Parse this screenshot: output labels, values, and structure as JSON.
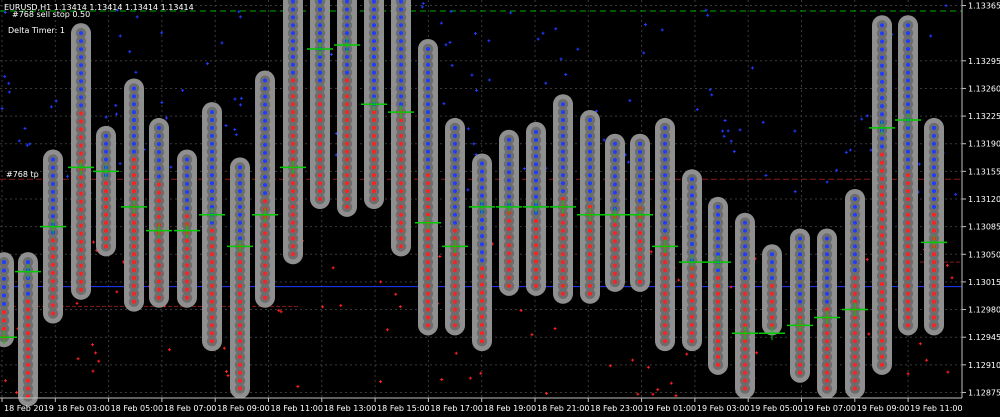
{
  "header": {
    "symbol_line": "EURUSD,H1  1.13414 1.13414 1.13414 1.13414",
    "order_line": "#768 sell stop 0.50",
    "delta_timer": "Delta Timer: 1",
    "tp_label": "#768 tp"
  },
  "colors": {
    "background": "#000000",
    "grid": "#3a3a3a",
    "axis_text": "#ffffff",
    "bubble": "#8f8f8f",
    "ask_dot": "#1e3cff",
    "bid_dot": "#ff2020",
    "level": "#00cc00",
    "tp_line": "#8b1a1a",
    "stop_line": "#00aa00",
    "blue_line": "#1e3cff"
  },
  "chart_data": {
    "type": "scatter",
    "description_free": true,
    "x_ticks": [
      "18 Feb 2019",
      "18 Feb 03:00",
      "18 Feb 05:00",
      "18 Feb 07:00",
      "18 Feb 09:00",
      "18 Feb 11:00",
      "18 Feb 13:00",
      "18 Feb 15:00",
      "18 Feb 17:00",
      "18 Feb 19:00",
      "18 Feb 21:00",
      "18 Feb 23:00",
      "19 Feb 01:00",
      "19 Feb 03:00",
      "19 Feb 05:00",
      "19 Feb 07:00",
      "19 Feb 09:00",
      "19 Feb 11:00"
    ],
    "y_ticks": [
      1.13365,
      1.13295,
      1.1326,
      1.13225,
      1.1319,
      1.13155,
      1.1312,
      1.13085,
      1.1305,
      1.13015,
      1.1298,
      1.12945,
      1.1291,
      1.12875
    ],
    "y_tick_labels": [
      "1.13365",
      "1.13295",
      "1.13260",
      "1.13225",
      "1.13190",
      "1.13155",
      "1.13120",
      "1.13085",
      "1.13050",
      "1.13015",
      "1.12980",
      "1.12945",
      "1.12910",
      "1.12875"
    ],
    "ylim": [
      1.12868,
      1.13372
    ],
    "levels": {
      "sell_stop": 1.13358,
      "take_profit": 1.13145,
      "blue_ref": 1.13009,
      "red_ref": 1.12984
    },
    "bars": [
      {
        "x": 4,
        "high": 1.1304,
        "low": 1.12945,
        "split": 1.1298,
        "level": 1.12945
      },
      {
        "x": 28,
        "high": 1.1304,
        "low": 1.1287,
        "split": 1.13,
        "level": 1.13028
      },
      {
        "x": 53,
        "high": 1.1317,
        "low": 1.12975,
        "split": 1.1307,
        "level": 1.13085
      },
      {
        "x": 81,
        "high": 1.1333,
        "low": 1.13005,
        "split": 1.1323,
        "level": 1.1316
      },
      {
        "x": 106,
        "high": 1.132,
        "low": 1.1306,
        "split": 1.1314,
        "level": 1.13155
      },
      {
        "x": 134,
        "high": 1.1326,
        "low": 1.1299,
        "split": 1.1318,
        "level": 1.1311
      },
      {
        "x": 159,
        "high": 1.1321,
        "low": 1.12995,
        "split": 1.1314,
        "level": 1.1308
      },
      {
        "x": 187,
        "high": 1.1317,
        "low": 1.12995,
        "split": 1.131,
        "level": 1.1308
      },
      {
        "x": 212,
        "high": 1.1323,
        "low": 1.1294,
        "split": 1.1309,
        "level": 1.131
      },
      {
        "x": 240,
        "high": 1.1316,
        "low": 1.1288,
        "split": 1.1306,
        "level": 1.1306
      },
      {
        "x": 265,
        "high": 1.1327,
        "low": 1.12995,
        "split": 1.1312,
        "level": 1.131
      },
      {
        "x": 293,
        "high": 1.1338,
        "low": 1.1305,
        "split": 1.1327,
        "level": 1.1316
      },
      {
        "x": 320,
        "high": 1.1338,
        "low": 1.1312,
        "split": 1.1326,
        "level": 1.1331
      },
      {
        "x": 347,
        "high": 1.1338,
        "low": 1.1311,
        "split": 1.1327,
        "level": 1.13315
      },
      {
        "x": 374,
        "high": 1.1338,
        "low": 1.1312,
        "split": 1.1323,
        "level": 1.1324
      },
      {
        "x": 401,
        "high": 1.1338,
        "low": 1.1306,
        "split": 1.1323,
        "level": 1.1323
      },
      {
        "x": 428,
        "high": 1.1331,
        "low": 1.1296,
        "split": 1.1316,
        "level": 1.1309
      },
      {
        "x": 455,
        "high": 1.1321,
        "low": 1.1296,
        "split": 1.1309,
        "level": 1.1306
      },
      {
        "x": 482,
        "high": 1.13165,
        "low": 1.1294,
        "split": 1.1304,
        "level": 1.1311
      },
      {
        "x": 509,
        "high": 1.13195,
        "low": 1.1301,
        "split": 1.1311,
        "level": 1.1311
      },
      {
        "x": 536,
        "high": 1.13205,
        "low": 1.1301,
        "split": 1.131,
        "level": 1.1311
      },
      {
        "x": 563,
        "high": 1.1324,
        "low": 1.13,
        "split": 1.1312,
        "level": 1.1311
      },
      {
        "x": 590,
        "high": 1.1322,
        "low": 1.13,
        "split": 1.1312,
        "level": 1.131
      },
      {
        "x": 615,
        "high": 1.1319,
        "low": 1.13015,
        "split": 1.131,
        "level": 1.131
      },
      {
        "x": 640,
        "high": 1.1319,
        "low": 1.13015,
        "split": 1.1311,
        "level": 1.131
      },
      {
        "x": 665,
        "high": 1.1321,
        "low": 1.1294,
        "split": 1.1307,
        "level": 1.1306
      },
      {
        "x": 692,
        "high": 1.13145,
        "low": 1.1294,
        "split": 1.1304,
        "level": 1.1304
      },
      {
        "x": 718,
        "high": 1.1311,
        "low": 1.1291,
        "split": 1.1302,
        "level": 1.1304
      },
      {
        "x": 745,
        "high": 1.1309,
        "low": 1.1288,
        "split": 1.1301,
        "level": 1.1295
      },
      {
        "x": 772,
        "high": 1.1305,
        "low": 1.1296,
        "split": 1.1301,
        "level": 1.1295
      },
      {
        "x": 800,
        "high": 1.1307,
        "low": 1.129,
        "split": 1.1299,
        "level": 1.1296
      },
      {
        "x": 827,
        "high": 1.1307,
        "low": 1.1288,
        "split": 1.1299,
        "level": 1.1297
      },
      {
        "x": 855,
        "high": 1.1312,
        "low": 1.1288,
        "split": 1.1302,
        "level": 1.1298
      },
      {
        "x": 882,
        "high": 1.1334,
        "low": 1.1291,
        "split": 1.1318,
        "level": 1.1321
      },
      {
        "x": 908,
        "high": 1.1334,
        "low": 1.1296,
        "split": 1.1316,
        "level": 1.1322
      },
      {
        "x": 934,
        "high": 1.1321,
        "low": 1.1296,
        "split": 1.1311,
        "level": 1.13065
      }
    ]
  }
}
